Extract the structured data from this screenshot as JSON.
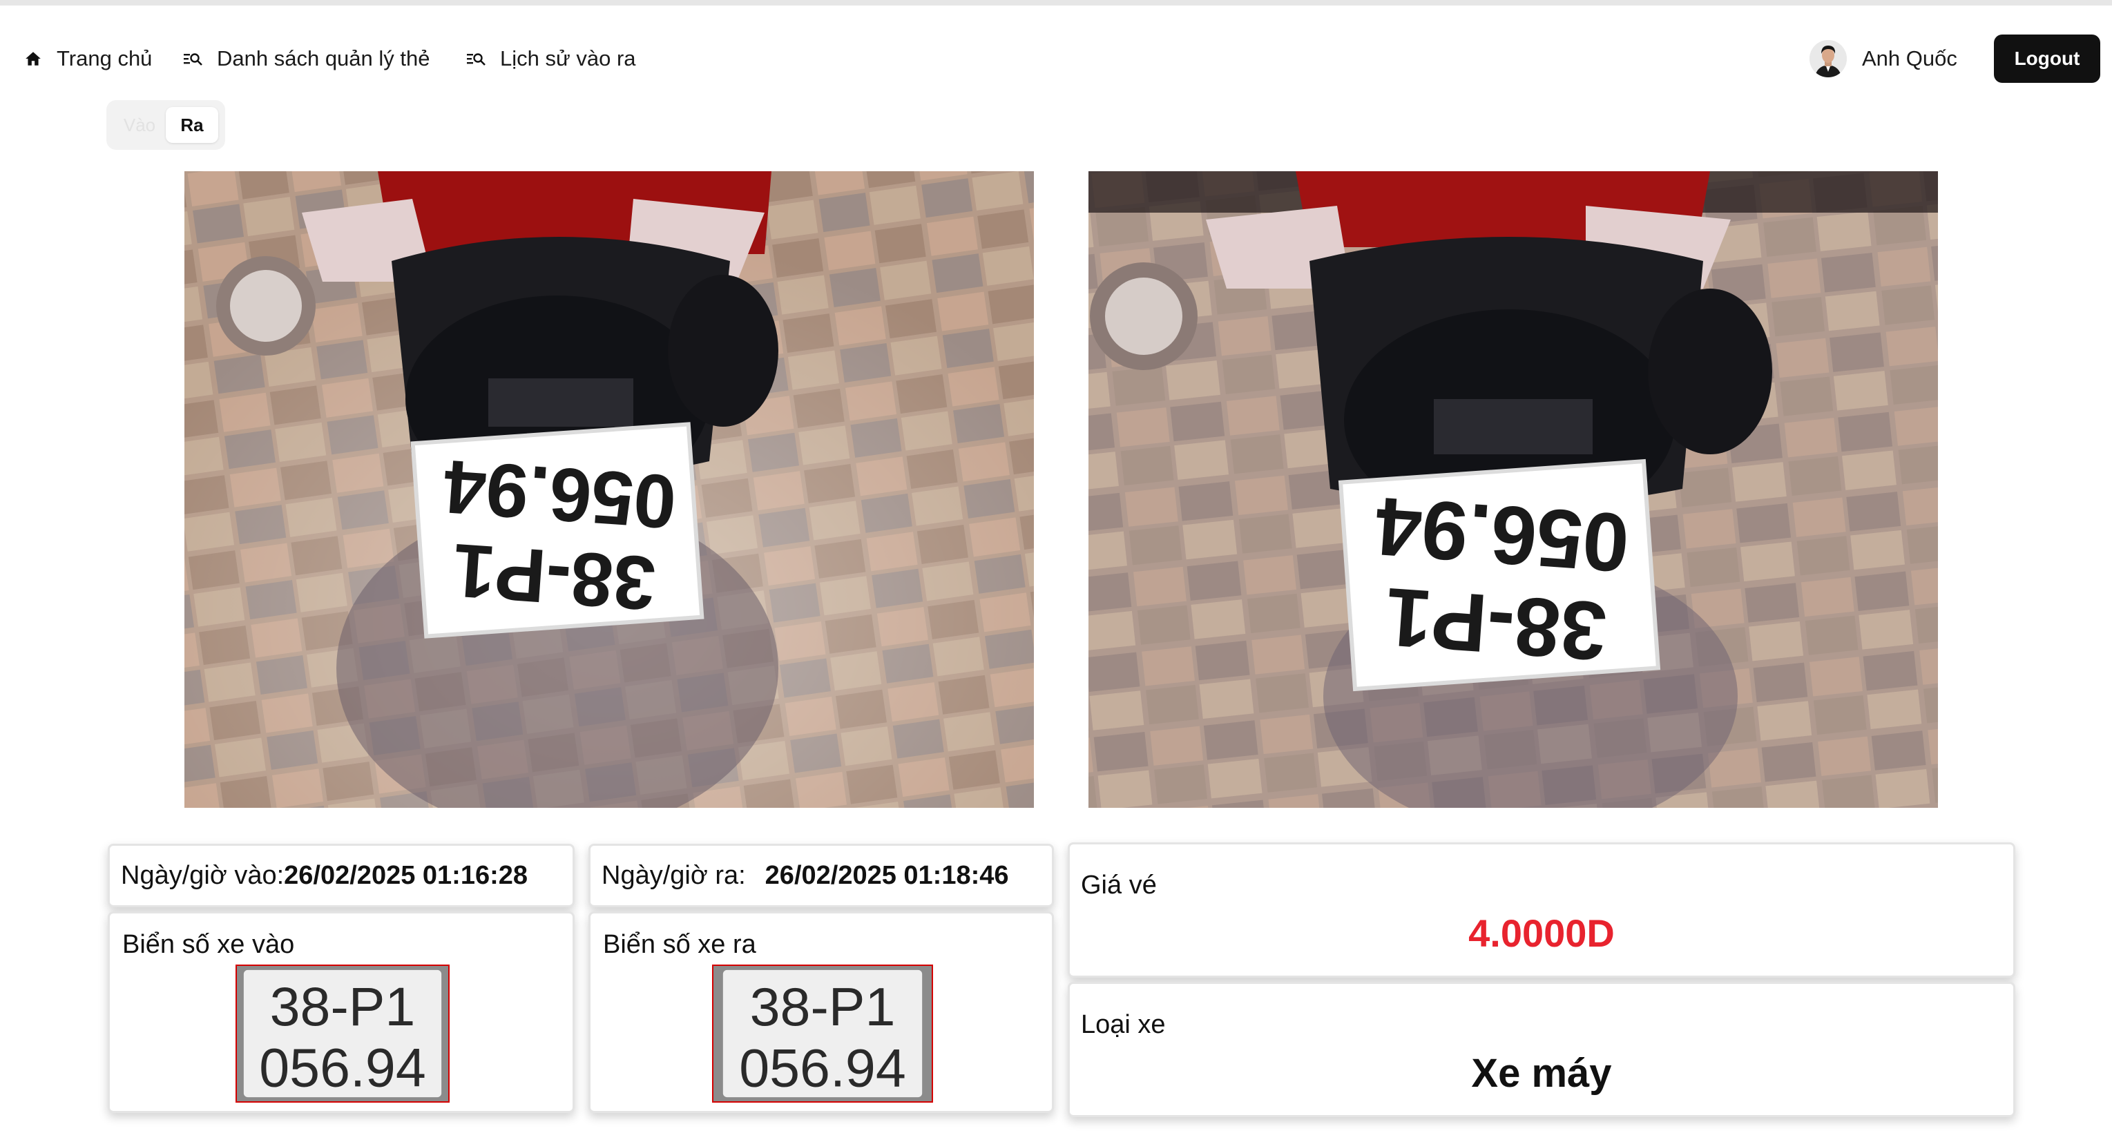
{
  "nav": {
    "home_label": "Trang chủ",
    "cards_label": "Danh sách quản lý thẻ",
    "history_label": "Lịch sử vào ra",
    "home_icon": "home-icon",
    "list_icon": "list-search-icon"
  },
  "user": {
    "name": "Anh Quốc",
    "logout_label": "Logout"
  },
  "toggle": {
    "options": [
      "Vào",
      "Ra"
    ],
    "selected": "Ra"
  },
  "entry": {
    "datetime_label": "Ngày/giờ vào:",
    "datetime_value": "26/02/2025 01:16:28",
    "plate_label": "Biển số xe vào",
    "plate_line1": "38-P1",
    "plate_line2": "056.94"
  },
  "exit": {
    "datetime_label": "Ngày/giờ ra:",
    "datetime_value": "26/02/2025 01:18:46",
    "plate_label": "Biển số xe ra",
    "plate_line1": "38-P1",
    "plate_line2": "056.94"
  },
  "fee": {
    "label": "Giá vé",
    "value": "4.0000D",
    "color": "#e8232e"
  },
  "vehicle": {
    "label": "Loại xe",
    "value": "Xe máy"
  }
}
